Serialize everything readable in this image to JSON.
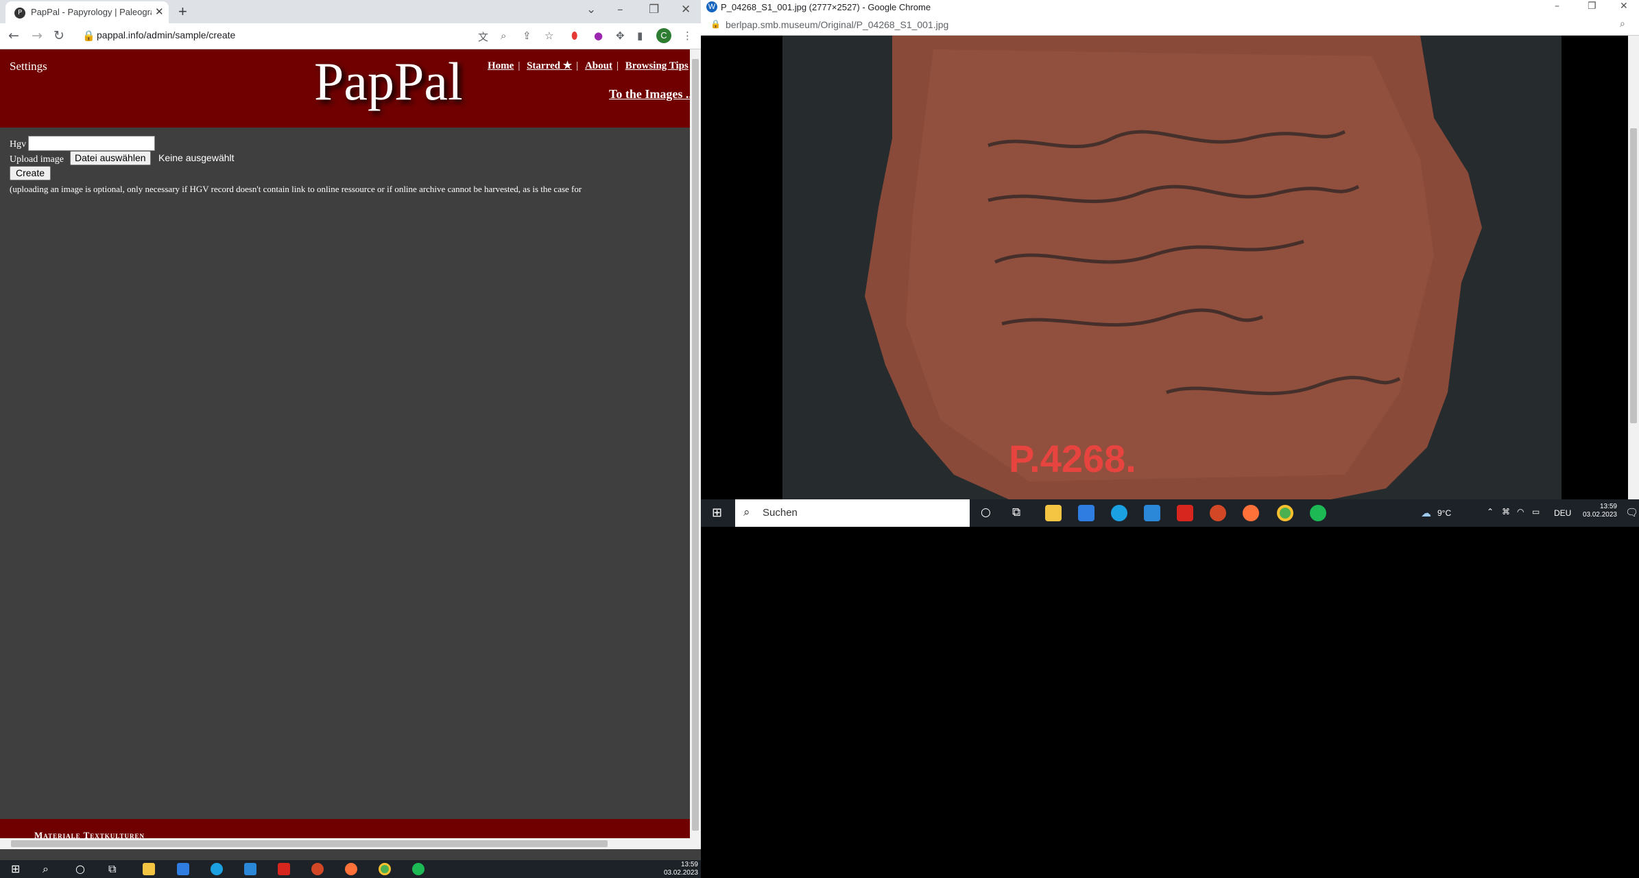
{
  "left_browser": {
    "tab_title": "PapPal - Papyrology | Paleograph",
    "url": "pappal.info/admin/sample/create",
    "profile_initial": "C"
  },
  "pappal": {
    "settings": "Settings",
    "logo": "PapPal",
    "nav": [
      "Home",
      "Starred ★",
      "About",
      "Browsing Tips"
    ],
    "to_images": "To the Images ...",
    "form": {
      "hgv_label": "Hgv",
      "hgv_value": "",
      "upload_label": "Upload image",
      "choose_file": "Datei auswählen",
      "no_file": "Keine ausgewählt",
      "create": "Create",
      "note": "(uploading an image is optional, only necessary if HGV record doesn't contain link to online ressource or if online archive cannot be harvested, as is the case for"
    },
    "footer": "Materiale Textkulturen"
  },
  "right_browser": {
    "title": "P_04268_S1_001.jpg (2777×2527) - Google Chrome",
    "url": "berlpap.smb.museum/Original/P_04268_S1_001.jpg",
    "ostracon_label": "P.4268."
  },
  "taskbar_small": {
    "search_placeholder": "Suchen",
    "weather": "9°C",
    "lang": "DEU",
    "time": "13:59",
    "date": "03.02.2023"
  },
  "taskbar_main": {
    "time": "13:59",
    "date": "03.02.2023"
  },
  "colors": {
    "header_red": "#700000",
    "page_bg": "#3f3f3f",
    "taskbar": "#1c2228"
  }
}
